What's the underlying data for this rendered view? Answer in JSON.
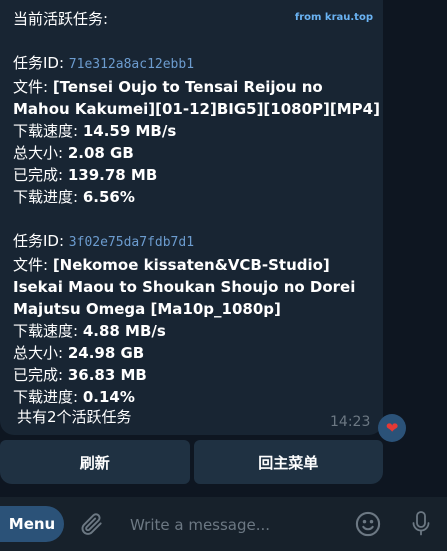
{
  "message": {
    "via": "from krau.top",
    "header": "当前活跃任务:",
    "tasks": [
      {
        "id_label": "任务ID: ",
        "id": "71e312a8ac12ebb1",
        "file_label": "文件: ",
        "file_line1": "[Tensei Oujo to Tensai Reijou no",
        "file_line2": "Mahou Kakumei][01-12]BIG5][1080P][MP4]",
        "speed_label": "下载速度: ",
        "speed": "14.59 MB/s",
        "size_label": "总大小: ",
        "size": "2.08 GB",
        "done_label": "已完成: ",
        "done": "139.78 MB",
        "progress_label": "下载进度: ",
        "progress": "6.56%"
      },
      {
        "id_label": "任务ID: ",
        "id": "3f02e75da7fdb7d1",
        "file_label": "文件: ",
        "file_line1": "[Nekomoe kissaten&VCB-Studio]",
        "file_line2": "Isekai Maou to Shoukan Shoujo no Dorei",
        "file_line3": "Majutsu Omega [Ma10p_1080p]",
        "speed_label": "下载速度: ",
        "speed": "4.88 MB/s",
        "size_label": "总大小: ",
        "size": "24.98 GB",
        "done_label": "已完成: ",
        "done": "36.83 MB",
        "progress_label": "下载进度: ",
        "progress": "0.14%"
      }
    ],
    "summary": "共有2个活跃任务",
    "time": "14:23",
    "reaction_icon": "heart-icon"
  },
  "keyboard": {
    "refresh_label": "刷新",
    "main_menu_label": "回主菜单"
  },
  "composer": {
    "menu_label": "Menu",
    "placeholder": "Write a message...",
    "attach_icon": "paperclip-icon",
    "emoji_icon": "emoji-icon",
    "mic_icon": "microphone-icon"
  },
  "colors": {
    "background": "#0e1621",
    "bubble": "#182533",
    "accent": "#6ab3f3",
    "mono_text": "#6c9ccf",
    "button": "#1f3142",
    "menu_button": "#2b5278",
    "reaction": "#e53935"
  }
}
